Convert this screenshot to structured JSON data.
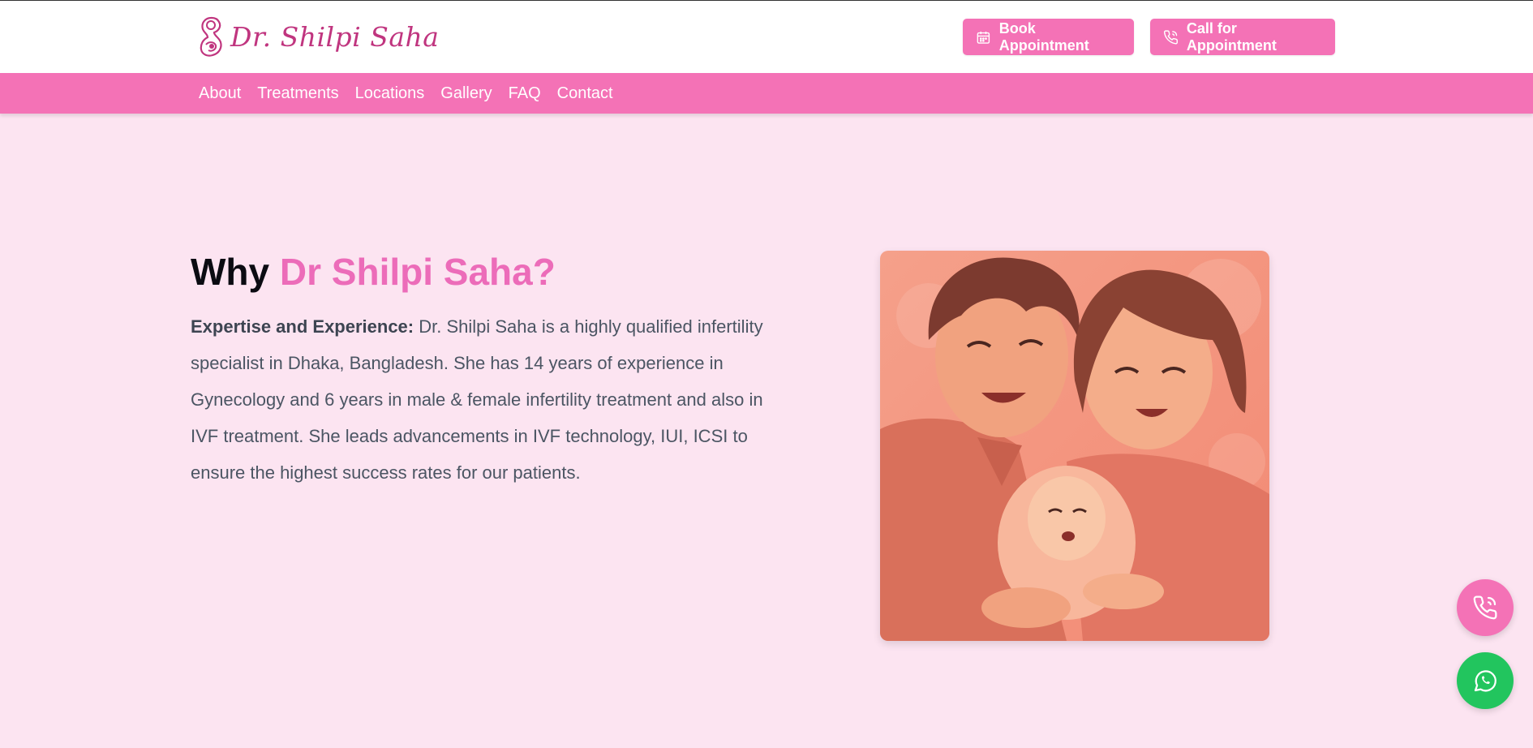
{
  "header": {
    "logo_text": "Dr. Shilpi Saha",
    "book_label": "Book Appointment",
    "call_label": "Call for Appointment"
  },
  "nav": {
    "items": [
      "About",
      "Treatments",
      "Locations",
      "Gallery",
      "FAQ",
      "Contact"
    ]
  },
  "section": {
    "title_prefix": "Why",
    "title_accent": "Dr Shilpi Saha?",
    "lead": "Expertise and Experience:",
    "body": " Dr. Shilpi Saha is a highly qualified infertility specialist in Dhaka, Bangladesh. She has 14 years of experience in Gynecology and 6 years in male & female infertility treatment and also in IVF treatment. She leads advancements in IVF technology, IUI, ICSI to ensure the highest success rates for our patients."
  },
  "colors": {
    "brand_pink": "#f472b6",
    "accent_pink": "#ec6cb9",
    "page_bg": "#fce4f1",
    "whatsapp_green": "#22c55e"
  },
  "icons": {
    "book": "calendar-icon",
    "call": "phone-call-icon",
    "fab_call": "phone-call-icon",
    "fab_whatsapp": "whatsapp-icon"
  }
}
